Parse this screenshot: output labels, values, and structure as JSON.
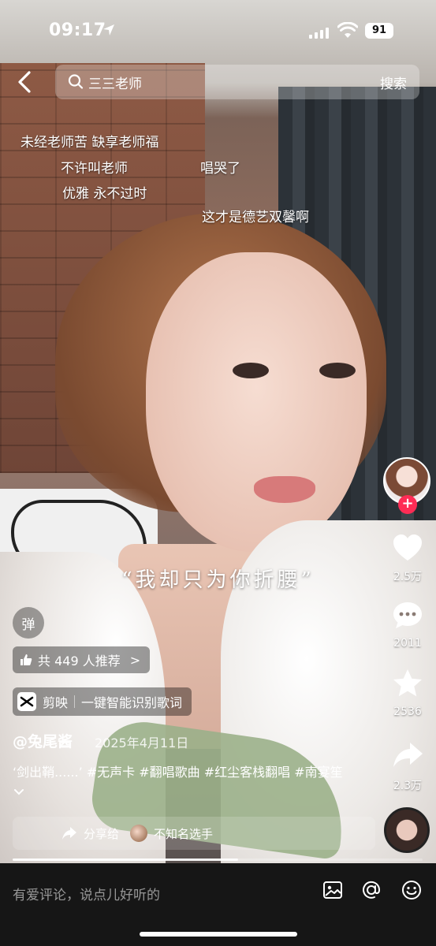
{
  "status_bar": {
    "time": "09:17",
    "battery": "91"
  },
  "search": {
    "query": "三三老师",
    "button": "搜索"
  },
  "danmaku": [
    "未经老师苦 缺享老师福",
    "不许叫老师",
    "唱哭了",
    "优雅 永不过时",
    "这才是德艺双馨啊"
  ],
  "lyric": "“我却只为你折腰”",
  "danmaku_toggle": "弹",
  "recommend": {
    "label": "共 449 人推荐",
    "chevron": ">"
  },
  "capcut": {
    "app": "剪映",
    "feature": "一键智能识别歌词"
  },
  "author": {
    "handle": "@兔尾酱",
    "date": "2025年4月11日"
  },
  "description": {
    "text": "‘剑出鞘......’ #无声卡 #翻唱歌曲 #红尘客栈翻唱 #南宴笙",
    "more_icon": "chevron-down"
  },
  "share": {
    "label": "分享给",
    "recipient": "不知名选手"
  },
  "progress": {
    "fraction": 0.55
  },
  "actions": {
    "like_count": "2.5万",
    "comment_count": "2011",
    "favorite_count": "2536",
    "share_count": "2.3万"
  },
  "comment_bar": {
    "placeholder": "有爱评论，说点儿好听的"
  },
  "colors": {
    "follow": "#fe2c55",
    "bar_bg": "#161616"
  }
}
